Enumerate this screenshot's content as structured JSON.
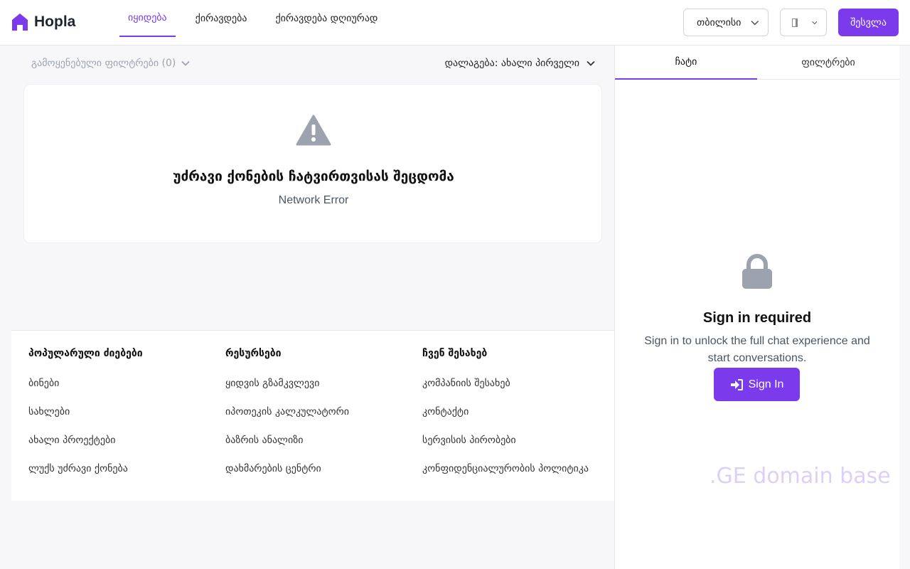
{
  "header": {
    "logo_text": "Hopla",
    "nav": [
      {
        "label": "იყიდება",
        "active": true
      },
      {
        "label": "ქირავდება",
        "active": false
      },
      {
        "label": "ქირავდება დღიურად",
        "active": false
      }
    ],
    "city_select": "თბილისი",
    "language_select": "",
    "login_label": "შესვლა"
  },
  "toolbar": {
    "applied_filters": "გამოყენებული ფილტრები (0)",
    "sort": "დალაგება: ახალი პირველი"
  },
  "error": {
    "title": "უძრავი ქონების ჩატვირთვისას შეცდომა",
    "message": "Network Error"
  },
  "footer": {
    "columns": [
      {
        "title": "პოპულარული ძიებები",
        "links": [
          "ბინები",
          "სახლები",
          "ახალი პროექტები",
          "ლუქს უძრავი ქონება"
        ]
      },
      {
        "title": "რესურსები",
        "links": [
          "ყიდვის გზამკვლევი",
          "იპოთეკის კალკულატორი",
          "ბაზრის ანალიზი",
          "დახმარების ცენტრი"
        ]
      },
      {
        "title": "ჩვენ შესახებ",
        "links": [
          "კომპანიის შესახებ",
          "კონტაქტი",
          "სერვისის პირობები",
          "კონფიდენციალურობის პოლიტიკა"
        ]
      }
    ]
  },
  "panel": {
    "tabs": [
      {
        "label": "ჩატი",
        "active": true
      },
      {
        "label": "ფილტრები",
        "active": false
      }
    ],
    "signin_title": "Sign in required",
    "signin_desc": "Sign in to unlock the full chat experience and start conversations.",
    "signin_button": "Sign In"
  },
  "watermark": ".GE domain base",
  "colors": {
    "accent": "#7c3aed",
    "icon_gray": "#9ca3af",
    "watermark": "#ddd0f7"
  },
  "icons": [
    "home-logo-icon",
    "chevron-down-icon",
    "warning-icon",
    "lock-icon",
    "sign-in-icon"
  ]
}
